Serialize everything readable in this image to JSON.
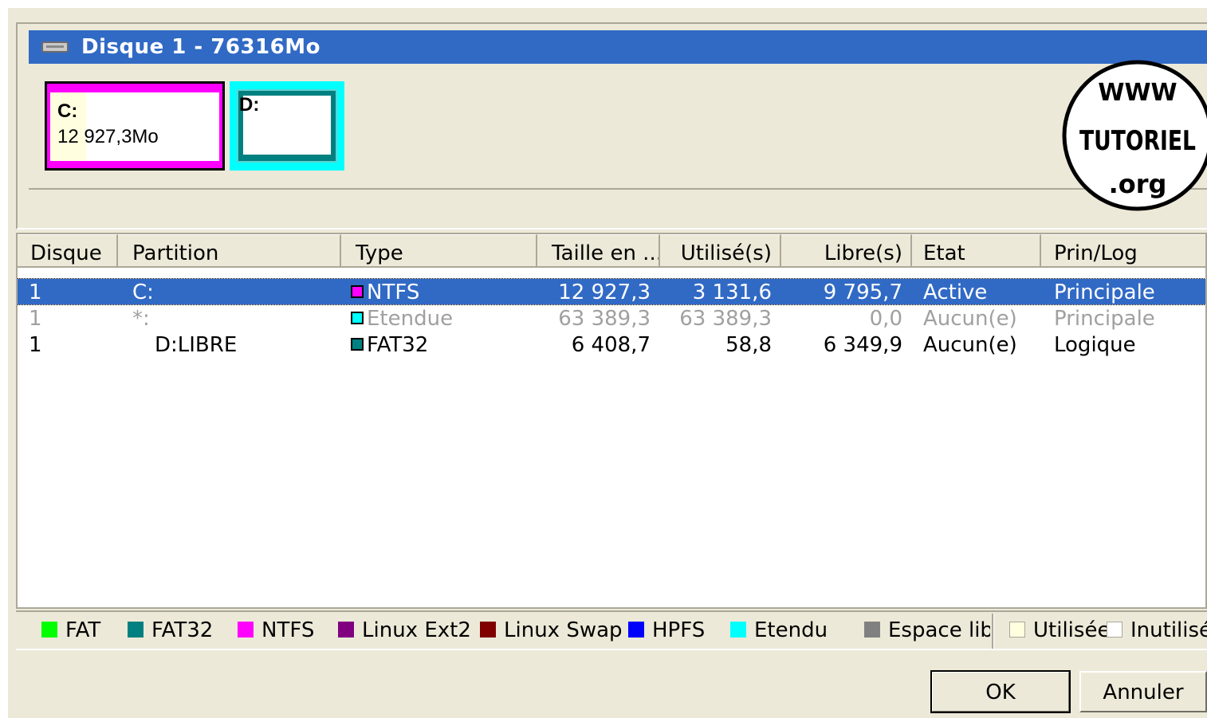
{
  "disk": {
    "title": "Disque 1 - 76316Mo",
    "partitions": [
      {
        "letter": "C:",
        "size": "12 927,3Mo",
        "color": "#ff00ff"
      },
      {
        "letter": "D:",
        "color": "#008080"
      }
    ]
  },
  "watermark": {
    "top": "WWW",
    "middle": "TUTORIEL",
    "bottom": ".org"
  },
  "table": {
    "columns": [
      "Disque",
      "Partition",
      "Type",
      "Taille en ...",
      "Utilisé(s)",
      "Libre(s)",
      "Etat",
      "Prin/Log"
    ],
    "rows": [
      {
        "disque": "1",
        "partition": "C:",
        "type": "NTFS",
        "type_color": "#ff00ff",
        "taille": "12 927,3",
        "utilise": "3 131,6",
        "libre": "9 795,7",
        "etat": "Active",
        "prinlog": "Principale",
        "state": "selected"
      },
      {
        "disque": "1",
        "partition": "*:",
        "type": "Etendue",
        "type_color": "#00ffff",
        "taille": "63 389,3",
        "utilise": "63 389,3",
        "libre": "0,0",
        "etat": "Aucun(e)",
        "prinlog": "Principale",
        "state": "dim"
      },
      {
        "disque": "1",
        "partition": "D:LIBRE",
        "type": "FAT32",
        "type_color": "#008080",
        "taille": "6 408,7",
        "utilise": "58,8",
        "libre": "6 349,9",
        "etat": "Aucun(e)",
        "prinlog": "Logique",
        "state": "normal"
      }
    ]
  },
  "legend": [
    {
      "label": "FAT",
      "color": "#00ff00"
    },
    {
      "label": "FAT32",
      "color": "#008080"
    },
    {
      "label": "NTFS",
      "color": "#ff00ff"
    },
    {
      "label": "Linux Ext2",
      "color": "#800080"
    },
    {
      "label": "Linux Swap",
      "color": "#800000"
    },
    {
      "label": "HPFS",
      "color": "#0000ff"
    },
    {
      "label": "Etendu",
      "color": "#00ffff"
    },
    {
      "label": "Espace libr",
      "color": "#808080"
    }
  ],
  "legend_usage": {
    "used": "Utilisée",
    "used_color": "#ffffe0",
    "unused": "Inutilisée",
    "unused_color": "#ffffff"
  },
  "buttons": {
    "ok": "OK",
    "cancel": "Annuler"
  }
}
